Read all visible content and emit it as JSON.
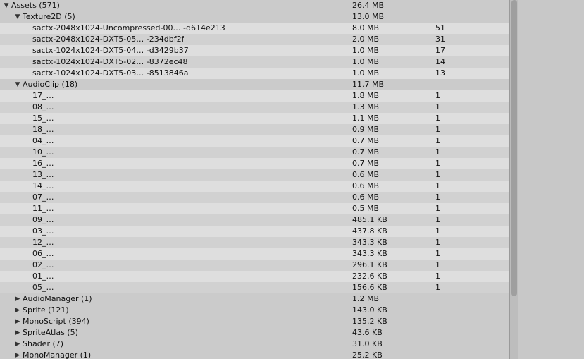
{
  "tree": {
    "rows": [
      {
        "label": "Assets (571)",
        "size": "26.4 MB",
        "count": "",
        "depth": 0,
        "toggle": "open",
        "style": "alt"
      },
      {
        "label": "Texture2D (5)",
        "size": "13.0 MB",
        "count": "",
        "depth": 1,
        "toggle": "open",
        "style": "alt"
      },
      {
        "label": "sactx-2048x1024-Uncompressed-00… -d614e213",
        "size": "8.0 MB",
        "count": "51",
        "depth": 2,
        "toggle": "",
        "style": "a"
      },
      {
        "label": "sactx-2048x1024-DXT5-05… -234dbf2f",
        "size": "2.0 MB",
        "count": "31",
        "depth": 2,
        "toggle": "",
        "style": "b"
      },
      {
        "label": "sactx-1024x1024-DXT5-04… -d3429b37",
        "size": "1.0 MB",
        "count": "17",
        "depth": 2,
        "toggle": "",
        "style": "a"
      },
      {
        "label": "sactx-1024x1024-DXT5-02… -8372ec48",
        "size": "1.0 MB",
        "count": "14",
        "depth": 2,
        "toggle": "",
        "style": "b"
      },
      {
        "label": "sactx-1024x1024-DXT5-03… -8513846a",
        "size": "1.0 MB",
        "count": "13",
        "depth": 2,
        "toggle": "",
        "style": "a"
      },
      {
        "label": "AudioClip (18)",
        "size": "11.7 MB",
        "count": "",
        "depth": 1,
        "toggle": "open",
        "style": "alt"
      },
      {
        "label": "17_…",
        "size": "1.8 MB",
        "count": "1",
        "depth": 2,
        "toggle": "",
        "style": "a"
      },
      {
        "label": "08_…",
        "size": "1.3 MB",
        "count": "1",
        "depth": 2,
        "toggle": "",
        "style": "b"
      },
      {
        "label": "15_…",
        "size": "1.1 MB",
        "count": "1",
        "depth": 2,
        "toggle": "",
        "style": "a"
      },
      {
        "label": "18_…",
        "size": "0.9 MB",
        "count": "1",
        "depth": 2,
        "toggle": "",
        "style": "b"
      },
      {
        "label": "04_…",
        "size": "0.7 MB",
        "count": "1",
        "depth": 2,
        "toggle": "",
        "style": "a"
      },
      {
        "label": "10_…",
        "size": "0.7 MB",
        "count": "1",
        "depth": 2,
        "toggle": "",
        "style": "b"
      },
      {
        "label": "16_…",
        "size": "0.7 MB",
        "count": "1",
        "depth": 2,
        "toggle": "",
        "style": "a"
      },
      {
        "label": "13_…",
        "size": "0.6 MB",
        "count": "1",
        "depth": 2,
        "toggle": "",
        "style": "b"
      },
      {
        "label": "14_…",
        "size": "0.6 MB",
        "count": "1",
        "depth": 2,
        "toggle": "",
        "style": "a"
      },
      {
        "label": "07_…",
        "size": "0.6 MB",
        "count": "1",
        "depth": 2,
        "toggle": "",
        "style": "b"
      },
      {
        "label": "11_…",
        "size": "0.5 MB",
        "count": "1",
        "depth": 2,
        "toggle": "",
        "style": "a"
      },
      {
        "label": "09_…",
        "size": "485.1 KB",
        "count": "1",
        "depth": 2,
        "toggle": "",
        "style": "b"
      },
      {
        "label": "03_…",
        "size": "437.8 KB",
        "count": "1",
        "depth": 2,
        "toggle": "",
        "style": "a"
      },
      {
        "label": "12_…",
        "size": "343.3 KB",
        "count": "1",
        "depth": 2,
        "toggle": "",
        "style": "b"
      },
      {
        "label": "06_…",
        "size": "343.3 KB",
        "count": "1",
        "depth": 2,
        "toggle": "",
        "style": "a"
      },
      {
        "label": "02_…",
        "size": "296.1 KB",
        "count": "1",
        "depth": 2,
        "toggle": "",
        "style": "b"
      },
      {
        "label": "01_…",
        "size": "232.6 KB",
        "count": "1",
        "depth": 2,
        "toggle": "",
        "style": "a"
      },
      {
        "label": "05_…",
        "size": "156.6 KB",
        "count": "1",
        "depth": 2,
        "toggle": "",
        "style": "b"
      },
      {
        "label": "AudioManager (1)",
        "size": "1.2 MB",
        "count": "",
        "depth": 1,
        "toggle": "closed",
        "style": "alt"
      },
      {
        "label": "Sprite (121)",
        "size": "143.0 KB",
        "count": "",
        "depth": 1,
        "toggle": "closed",
        "style": "alt"
      },
      {
        "label": "MonoScript (394)",
        "size": "135.2 KB",
        "count": "",
        "depth": 1,
        "toggle": "closed",
        "style": "alt"
      },
      {
        "label": "SpriteAtlas (5)",
        "size": "43.6 KB",
        "count": "",
        "depth": 1,
        "toggle": "closed",
        "style": "alt"
      },
      {
        "label": "Shader (7)",
        "size": "31.0 KB",
        "count": "",
        "depth": 1,
        "toggle": "closed",
        "style": "alt"
      },
      {
        "label": "MonoManager (1)",
        "size": "25.2 KB",
        "count": "",
        "depth": 1,
        "toggle": "closed",
        "style": "alt"
      }
    ]
  },
  "icons": {
    "open": "triangle-down-icon",
    "closed": "triangle-right-icon"
  }
}
